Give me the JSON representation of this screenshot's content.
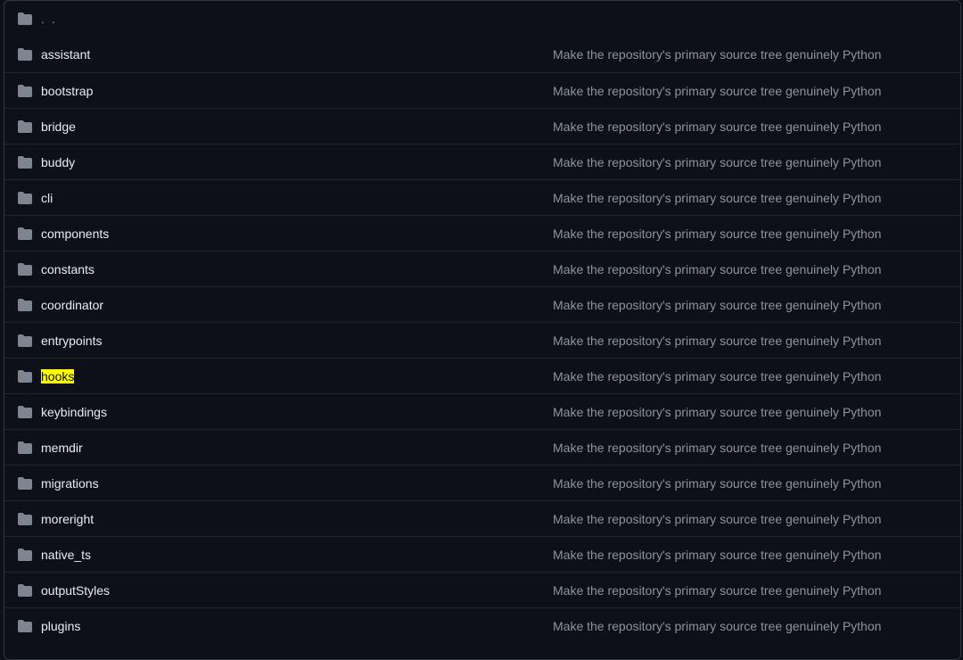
{
  "parent": {
    "label": ". .",
    "icon": "folder-icon"
  },
  "commit_message": "Make the repository's primary source tree genuinely Python",
  "highlight_color": "#ffff00",
  "folder_color": "#7d8590",
  "rows": [
    {
      "name": "assistant",
      "message": "Make the repository's primary source tree genuinely Python"
    },
    {
      "name": "bootstrap",
      "message": "Make the repository's primary source tree genuinely Python"
    },
    {
      "name": "bridge",
      "message": "Make the repository's primary source tree genuinely Python"
    },
    {
      "name": "buddy",
      "message": "Make the repository's primary source tree genuinely Python"
    },
    {
      "name": "cli",
      "message": "Make the repository's primary source tree genuinely Python"
    },
    {
      "name": "components",
      "message": "Make the repository's primary source tree genuinely Python"
    },
    {
      "name": "constants",
      "message": "Make the repository's primary source tree genuinely Python"
    },
    {
      "name": "coordinator",
      "message": "Make the repository's primary source tree genuinely Python"
    },
    {
      "name": "entrypoints",
      "message": "Make the repository's primary source tree genuinely Python"
    },
    {
      "name": "hooks",
      "message": "Make the repository's primary source tree genuinely Python",
      "highlighted": true
    },
    {
      "name": "keybindings",
      "message": "Make the repository's primary source tree genuinely Python"
    },
    {
      "name": "memdir",
      "message": "Make the repository's primary source tree genuinely Python"
    },
    {
      "name": "migrations",
      "message": "Make the repository's primary source tree genuinely Python"
    },
    {
      "name": "moreright",
      "message": "Make the repository's primary source tree genuinely Python"
    },
    {
      "name": "native_ts",
      "message": "Make the repository's primary source tree genuinely Python"
    },
    {
      "name": "outputStyles",
      "message": "Make the repository's primary source tree genuinely Python"
    },
    {
      "name": "plugins",
      "message": "Make the repository's primary source tree genuinely Python"
    }
  ]
}
